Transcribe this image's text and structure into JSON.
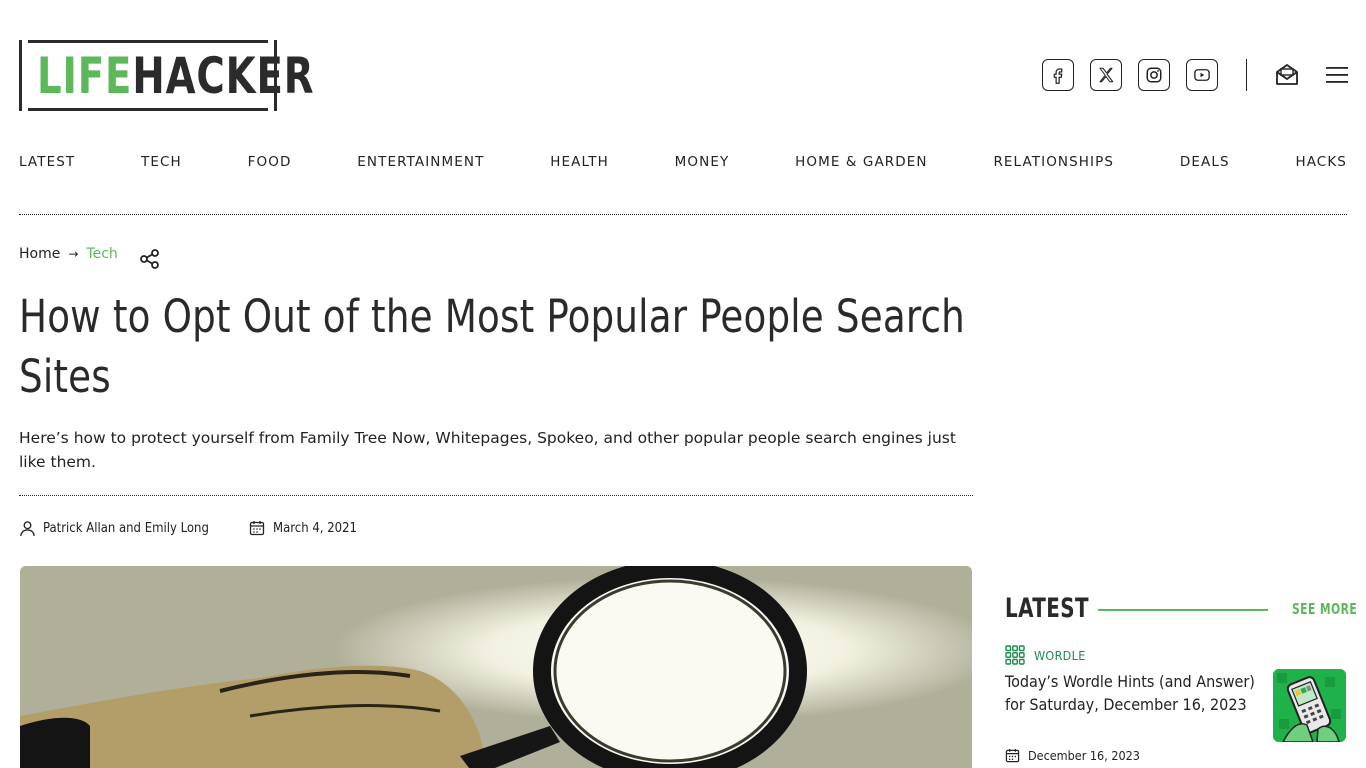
{
  "brand": {
    "life": "LIFE",
    "hacker": "HACKER",
    "accent_color": "#5db75b"
  },
  "header": {
    "social_icons": [
      "facebook-icon",
      "x-icon",
      "instagram-icon",
      "youtube-icon"
    ],
    "newsletter_icon": "mail-icon",
    "menu_icon": "hamburger-menu-icon"
  },
  "nav": {
    "items": [
      "LATEST",
      "TECH",
      "FOOD",
      "ENTERTAINMENT",
      "HEALTH",
      "MONEY",
      "HOME & GARDEN",
      "RELATIONSHIPS",
      "DEALS",
      "HACKS"
    ]
  },
  "breadcrumb": {
    "home": "Home",
    "arrow": "→",
    "section": "Tech"
  },
  "article": {
    "title": "How to Opt Out of the Most Popular People Search Sites",
    "subtitle": "Here’s how to protect yourself from Family Tree Now, Whitepages, Spokeo, and other popular people search engines just like them.",
    "authors": "Patrick Allan and Emily Long",
    "date": "March 4, 2021"
  },
  "sidebar": {
    "heading": "LATEST",
    "see_more": "SEE MORE",
    "items": [
      {
        "category": "WORDLE",
        "title": "Today’s Wordle Hints (and Answer) for Saturday, December 16, 2023",
        "date": "December 16, 2023"
      }
    ]
  }
}
